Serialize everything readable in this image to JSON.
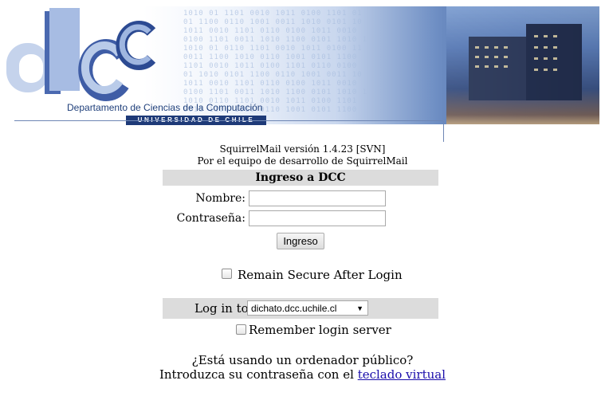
{
  "banner": {
    "department": "Departamento de Ciencias de la Computación",
    "university": "UNIVERSIDAD DE CHILE",
    "logo_text": "dcc"
  },
  "version": {
    "line1": "SquirrelMail versión 1.4.23 [SVN]",
    "line2": "Por el equipo de desarrollo de SquirrelMail"
  },
  "login": {
    "title": "Ingreso a DCC",
    "name_label": "Nombre:",
    "name_value": "",
    "password_label": "Contraseña:",
    "password_value": "",
    "submit_label": "Ingreso",
    "secure_label": "Remain Secure After Login",
    "secure_checked": false
  },
  "server": {
    "label": "Log in to:",
    "selected": "dichato.dcc.uchile.cl",
    "remember_label": "Remember login server",
    "remember_checked": false
  },
  "public": {
    "question": "¿Está usando un ordenador público?",
    "hint_prefix": "Introduzca su contraseña con el",
    "link": "teclado virtual"
  }
}
